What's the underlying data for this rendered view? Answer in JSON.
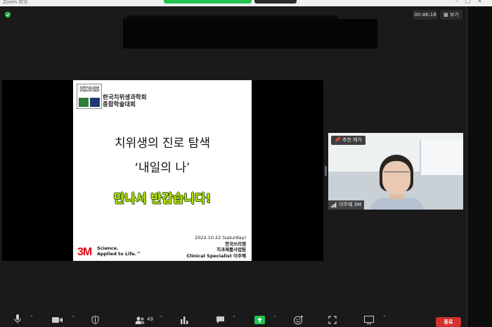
{
  "window": {
    "title": "Zoom 회의"
  },
  "header": {
    "timer": "00:46:18",
    "view_label": "보기"
  },
  "slide": {
    "org_name_line1": "한국치위생과학회",
    "org_name_line2": "종합학술대회",
    "title_line1": "치위생의 진로 탐색",
    "title_line2": "‘내일의 나’",
    "greeting": "만나서 반갑습니다!",
    "date": "2022.10.22 (saturday)",
    "company": "한국쓰리엠",
    "division": "치과제품사업팀",
    "presenter": "Clinical Specialist  이주혜",
    "brand": "3M",
    "tagline_line1": "Science.",
    "tagline_line2": "Applied to Life.™"
  },
  "video": {
    "pin_label": "추천 제거",
    "participant_name": "이주혜 3M"
  },
  "toolbar": {
    "participants_count": "49",
    "end_label": "종료"
  },
  "colors": {
    "share_green": "#23c552",
    "end_red": "#d2322d",
    "greeting_yellow": "#c8e600"
  }
}
